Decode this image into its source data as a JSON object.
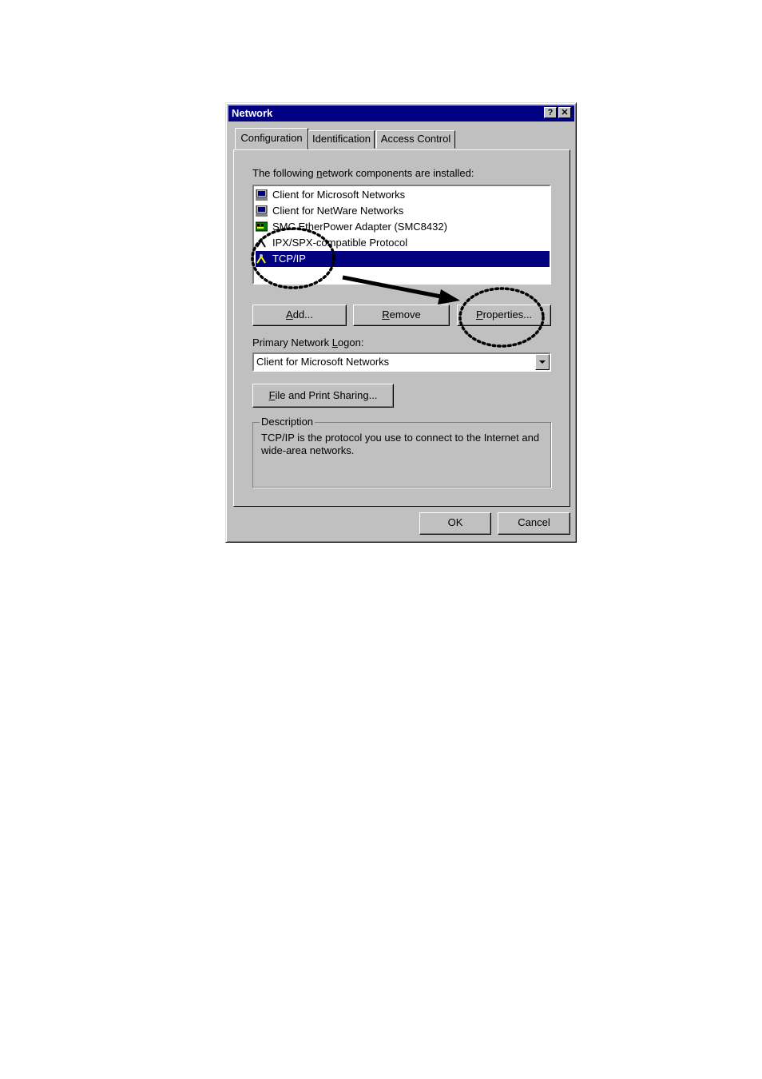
{
  "window": {
    "title": "Network",
    "help_glyph": "?",
    "close_glyph": "✕"
  },
  "tabs": [
    {
      "label": "Configuration",
      "active": true
    },
    {
      "label": "Identification",
      "active": false
    },
    {
      "label": "Access Control",
      "active": false
    }
  ],
  "components": {
    "label_pre": "The following ",
    "label_key": "n",
    "label_post": "etwork components are installed:",
    "items": [
      {
        "label": "Client for Microsoft Networks",
        "icon": "computer-icon",
        "selected": false
      },
      {
        "label": "Client for NetWare Networks",
        "icon": "computer-icon",
        "selected": false
      },
      {
        "label": "SMC EtherPower Adapter (SMC8432)",
        "icon": "network-adapter-icon",
        "selected": false
      },
      {
        "label": "IPX/SPX-compatible Protocol",
        "icon": "protocol-icon",
        "selected": false
      },
      {
        "label": "TCP/IP",
        "icon": "protocol-icon",
        "selected": true
      }
    ]
  },
  "buttons": {
    "add_key": "A",
    "add_rest": "dd...",
    "remove_key": "R",
    "remove_rest": "emove",
    "properties_key": "P",
    "properties_rest": "roperties...",
    "file_sharing_key": "F",
    "file_sharing_rest": "ile and Print Sharing...",
    "ok": "OK",
    "cancel": "Cancel"
  },
  "logon": {
    "label_pre": "Primary Network ",
    "label_key": "L",
    "label_post": "ogon:",
    "value": "Client for Microsoft Networks"
  },
  "description": {
    "title": "Description",
    "text": "TCP/IP is the protocol you use to connect to the Internet and wide-area networks."
  },
  "annotation": {
    "style": "dotted circles with arrow",
    "color": "#000000"
  }
}
